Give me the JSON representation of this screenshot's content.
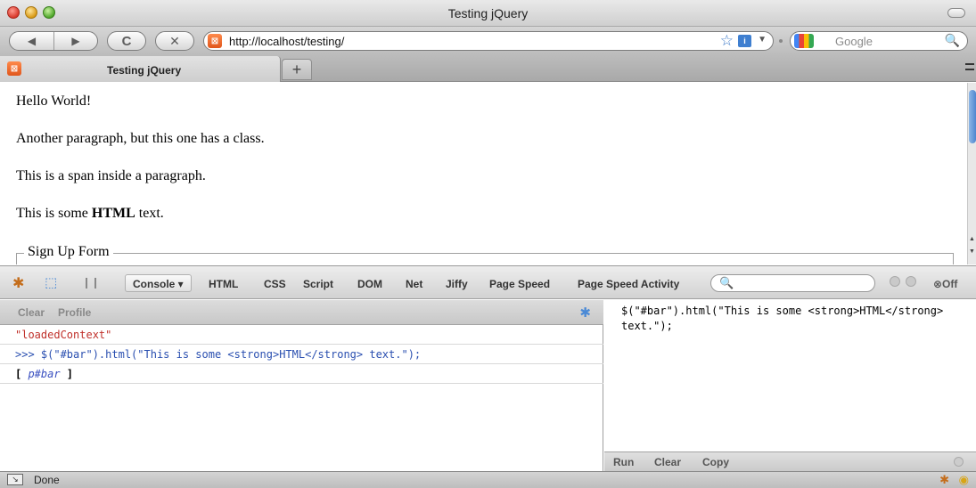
{
  "window": {
    "title": "Testing jQuery"
  },
  "nav": {
    "back_icon": "◀",
    "forward_icon": "▶",
    "reload_icon": "C",
    "stop_icon": "✕",
    "url": "http://localhost/testing/",
    "star_icon": "☆",
    "rss_icon": "i",
    "dropdown_icon": "▼",
    "search_placeholder": "Google",
    "search_icon": "🔍"
  },
  "tabs": {
    "active_label": "Testing jQuery",
    "favicon_glyph": "⊠",
    "new_tab_label": "+"
  },
  "page": {
    "p1": "Hello World!",
    "p2": "Another paragraph, but this one has a class.",
    "p3": "This is a span inside a paragraph.",
    "p4_before": "This is some ",
    "p4_strong": "HTML",
    "p4_after": " text.",
    "fieldset_legend": "Sign Up Form"
  },
  "firebug": {
    "tabs": [
      "Console ▾",
      "HTML",
      "CSS",
      "Script",
      "DOM",
      "Net",
      "Jiffy",
      "Page Speed",
      "Page Speed Activity"
    ],
    "off_label": "⊗Off",
    "console_toolbar": {
      "clear": "Clear",
      "profile": "Profile"
    },
    "log": {
      "row1": "\"loadedContext\"",
      "row2": ">>> $(\"#bar\").html(\"This is some <strong>HTML</strong> text.\");",
      "row3_open": "[ ",
      "row3_elem": "p#bar",
      "row3_close": " ]"
    },
    "editor_text": "$(\"#bar\").html(\"This is some <strong>HTML</strong>\ntext.\");",
    "editor_buttons": {
      "run": "Run",
      "clear": "Clear",
      "copy": "Copy"
    }
  },
  "status": {
    "text": "Done"
  },
  "colors": {
    "error_string": "#c0302a",
    "command_blue": "#2a4fb0",
    "firebug_orange": "#c46d1b"
  }
}
